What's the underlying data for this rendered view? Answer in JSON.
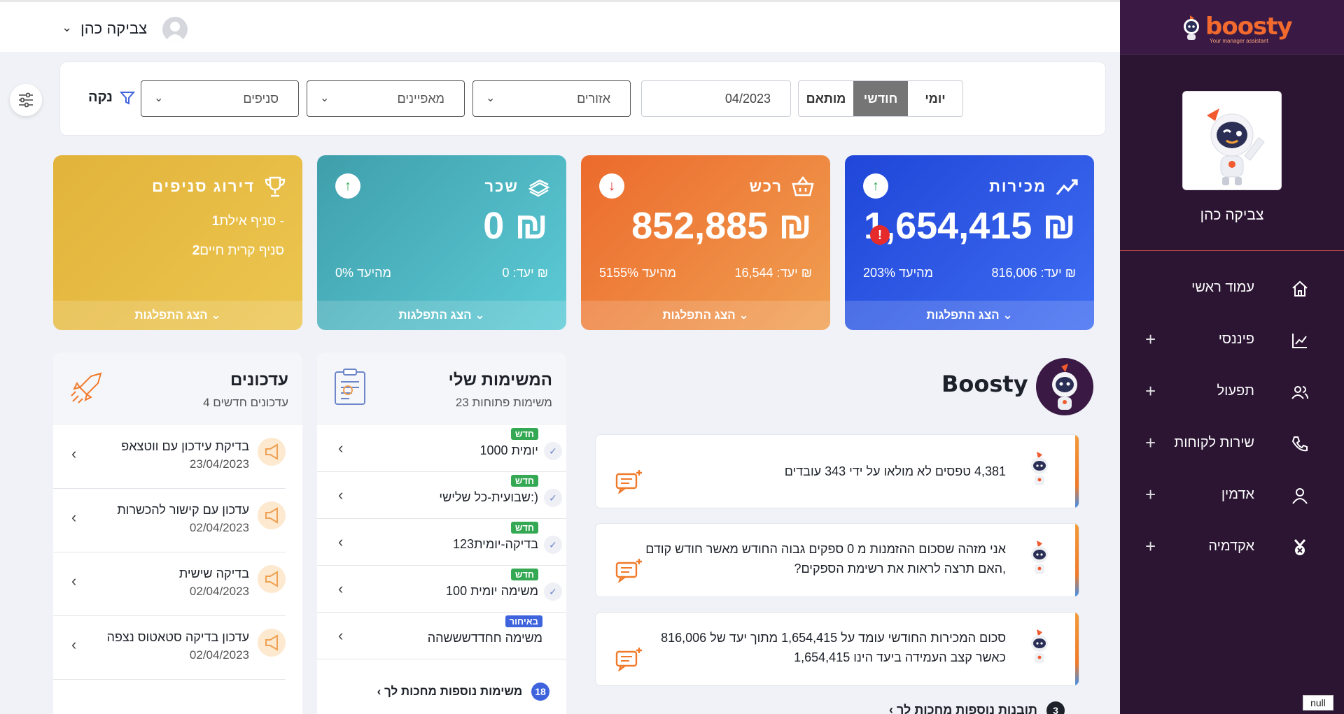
{
  "header": {
    "user_name": "צביקה כהן"
  },
  "sidebar": {
    "brand": "boosty",
    "brand_sub": "Your manager assistant",
    "profile_name": "צביקה כהן",
    "items": [
      {
        "label": "עמוד ראשי",
        "icon": "home-icon"
      },
      {
        "label": "פיננסי",
        "icon": "chart-icon"
      },
      {
        "label": "תפעול",
        "icon": "users-icon"
      },
      {
        "label": "שירות לקוחות",
        "icon": "phone-icon"
      },
      {
        "label": "אדמין",
        "icon": "user-icon"
      },
      {
        "label": "אקדמיה",
        "icon": "medal-icon"
      }
    ],
    "plus": "+"
  },
  "filters": {
    "periods": [
      "יומי",
      "חודשי",
      "מותאם"
    ],
    "active_period": "חודשי",
    "date": "04/2023",
    "regions": "אזורים",
    "features": "מאפיינים",
    "branches": "סניפים",
    "clear": "נקה"
  },
  "kpis": {
    "sales": {
      "title": "מכירות",
      "value": "1,654,415 ₪",
      "target": "יעד: 816,006 ₪",
      "pct": "203% מהיעד",
      "footer": "הצג התפלגות",
      "trend": "↑",
      "alert": "!"
    },
    "purchases": {
      "title": "רכש",
      "value": "852,885 ₪",
      "target": "יעד: 16,544 ₪",
      "pct": "5155% מהיעד",
      "footer": "הצג התפלגות",
      "trend": "↓"
    },
    "salary": {
      "title": "שכר",
      "value": "0 ₪",
      "target": "יעד: 0 ₪",
      "pct": "0% מהיעד",
      "footer": "הצג התפלגות",
      "trend": "↑"
    },
    "ranking": {
      "title": "דירוג סניפים",
      "rows": [
        {
          "num": "1",
          "name": "סניף אילת -"
        },
        {
          "num": "2",
          "name": "סניף קרית חיים"
        }
      ],
      "footer": "הצג התפלגות"
    }
  },
  "tasks": {
    "title": "המשימות שלי",
    "subtitle": "23 משימות פתוחות",
    "items": [
      {
        "name": "יומית 1000",
        "badge": "חדש",
        "badge_color": "#34a853"
      },
      {
        "name": "שבועית-כל שלישי:)",
        "badge": "חדש",
        "badge_color": "#34a853"
      },
      {
        "name": "בדיקה-יומית123",
        "badge": "חדש",
        "badge_color": "#34a853"
      },
      {
        "name": "משימה יומית 100",
        "badge": "חדש",
        "badge_color": "#34a853"
      },
      {
        "name": "משימה חחדדשששהה",
        "badge": "באיחור",
        "badge_color": "#3e63dd"
      }
    ],
    "more_count": "18",
    "more_label": "משימות נוספות מחכות לך"
  },
  "updates": {
    "title": "עדכונים",
    "subtitle": "4 עדכונים חדשים",
    "items": [
      {
        "title": "בדיקת עידכון עם ווטצאפ",
        "date": "23/04/2023"
      },
      {
        "title": "עדכון עם קישור להכשרות",
        "date": "02/04/2023"
      },
      {
        "title": "בדיקה שישית",
        "date": "02/04/2023"
      },
      {
        "title": "עדכון בדיקה סטאטוס נצפה",
        "date": "02/04/2023"
      }
    ]
  },
  "boosty": {
    "title": "Boosty",
    "messages": [
      "4,381 טפסים לא מולאו על ידי 343 עובדים",
      "אני מזהה שסכום ההזמנות מ 0 ספקים גבוה החודש מאשר חודש קודם ,האם תרצה לראות את רשימת הספקים?",
      "סכום המכירות החודשי עומד על 1,654,415 מתוך יעד של 816,006 כאשר קצב העמידה ביעד הינו 1,654,415"
    ],
    "more_count": "3",
    "more_label": "תובנות נוספות מחכות לך"
  },
  "null_tag": "null",
  "colors": {
    "sidebar": "#2b1533",
    "sales": "#2f5de8",
    "purchases": "#ef7a3a",
    "salary": "#4bb8c6",
    "ranking": "#e6b63a"
  }
}
